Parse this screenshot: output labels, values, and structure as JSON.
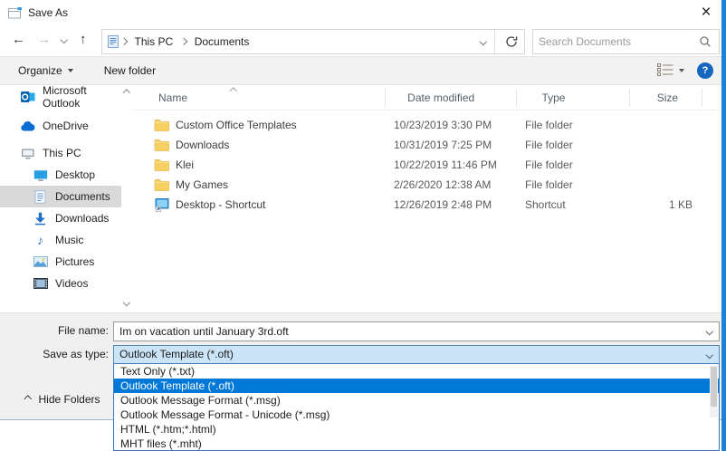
{
  "window": {
    "title": "Save As"
  },
  "icons": {
    "close": "×",
    "back": "←",
    "forward": "→",
    "up": "↑",
    "help": "?"
  },
  "navbar": {
    "breadcrumb": [
      "This PC",
      "Documents"
    ],
    "search_placeholder": "Search Documents"
  },
  "toolbar": {
    "organize_label": "Organize",
    "new_folder_label": "New folder"
  },
  "sidebar": {
    "items": [
      {
        "label": "Microsoft Outlook",
        "icon": "outlook-icon",
        "indent": false,
        "selected": false
      },
      {
        "label": "OneDrive",
        "icon": "onedrive-icon",
        "indent": false,
        "selected": false
      },
      {
        "label": "This PC",
        "icon": "pc-icon",
        "indent": false,
        "selected": false
      },
      {
        "label": "Desktop",
        "icon": "desktop-icon",
        "indent": true,
        "selected": false
      },
      {
        "label": "Documents",
        "icon": "documents-icon",
        "indent": true,
        "selected": true
      },
      {
        "label": "Downloads",
        "icon": "downloads-icon",
        "indent": true,
        "selected": false
      },
      {
        "label": "Music",
        "icon": "music-icon",
        "indent": true,
        "selected": false
      },
      {
        "label": "Pictures",
        "icon": "pictures-icon",
        "indent": true,
        "selected": false
      },
      {
        "label": "Videos",
        "icon": "videos-icon",
        "indent": true,
        "selected": false
      }
    ]
  },
  "filelist": {
    "columns": [
      "Name",
      "Date modified",
      "Type",
      "Size"
    ],
    "rows": [
      {
        "name": "Custom Office Templates",
        "date": "10/23/2019 3:30 PM",
        "type": "File folder",
        "size": "",
        "icon": "folder-icon"
      },
      {
        "name": "Downloads",
        "date": "10/31/2019 7:25 PM",
        "type": "File folder",
        "size": "",
        "icon": "folder-icon"
      },
      {
        "name": "Klei",
        "date": "10/22/2019 11:46 PM",
        "type": "File folder",
        "size": "",
        "icon": "folder-icon"
      },
      {
        "name": "My Games",
        "date": "2/26/2020 12:38 AM",
        "type": "File folder",
        "size": "",
        "icon": "folder-icon"
      },
      {
        "name": "Desktop - Shortcut",
        "date": "12/26/2019 2:48 PM",
        "type": "Shortcut",
        "size": "1 KB",
        "icon": "shortcut-icon"
      }
    ]
  },
  "footer": {
    "file_name_label": "File name:",
    "file_name_value": "Im on vacation until January 3rd.oft",
    "save_type_label": "Save as type:",
    "save_type_value": "Outlook Template (*.oft)",
    "hide_folders_label": "Hide Folders"
  },
  "dropdown": {
    "options": [
      {
        "label": "Text Only (*.txt)",
        "selected": false
      },
      {
        "label": "Outlook Template (*.oft)",
        "selected": true
      },
      {
        "label": "Outlook Message Format (*.msg)",
        "selected": false
      },
      {
        "label": "Outlook Message Format - Unicode (*.msg)",
        "selected": false
      },
      {
        "label": "HTML (*.htm;*.html)",
        "selected": false
      },
      {
        "label": "MHT files (*.mht)",
        "selected": false
      }
    ]
  },
  "colors": {
    "accent_border": "#1a82d8",
    "selection_blue": "#0078d7",
    "combobox_bg": "#cce4f7",
    "sidebar_selected": "#d9d9d9",
    "folder_yellow": "#f7d064"
  }
}
